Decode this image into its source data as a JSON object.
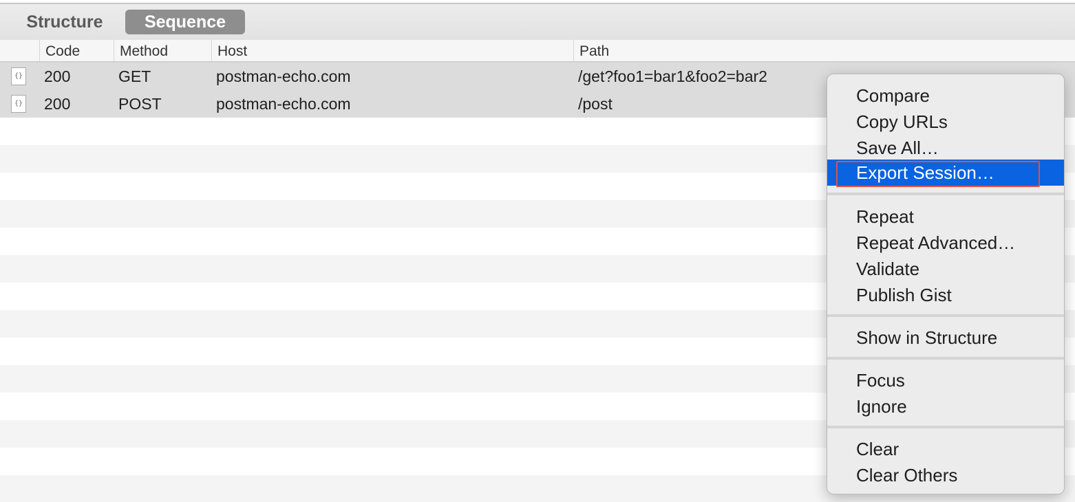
{
  "tabs": {
    "structure": "Structure",
    "sequence": "Sequence"
  },
  "columns": {
    "code": "Code",
    "method": "Method",
    "host": "Host",
    "path": "Path"
  },
  "requests": [
    {
      "icon": "json-file-icon",
      "icon_glyph": "{}",
      "code": "200",
      "method": "GET",
      "host": "postman-echo.com",
      "path": "/get?foo1=bar1&foo2=bar2"
    },
    {
      "icon": "json-file-icon",
      "icon_glyph": "{}",
      "code": "200",
      "method": "POST",
      "host": "postman-echo.com",
      "path": "/post"
    }
  ],
  "context_menu": {
    "groups": [
      [
        "Compare",
        "Copy URLs",
        "Save All…",
        "Export Session…"
      ],
      [
        "Repeat",
        "Repeat Advanced…",
        "Validate",
        "Publish Gist"
      ],
      [
        "Show in Structure"
      ],
      [
        "Focus",
        "Ignore"
      ],
      [
        "Clear",
        "Clear Others"
      ]
    ],
    "selected": "Export Session…"
  },
  "colors": {
    "selection": "#0a63e0",
    "highlight_outline": "#e0504a",
    "active_tab": "#8e8e8e"
  }
}
